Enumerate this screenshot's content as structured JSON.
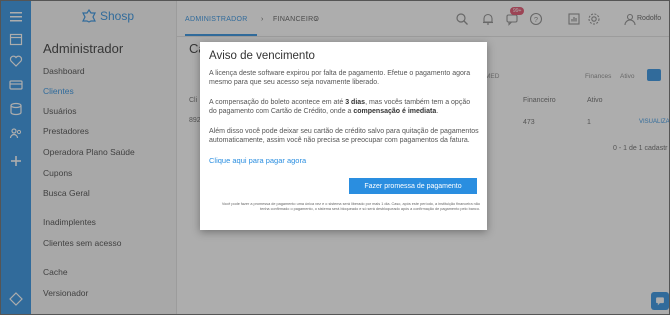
{
  "brand": {
    "name": "Shosp"
  },
  "menu": {
    "title": "Administrador",
    "items": [
      {
        "label": "Dashboard"
      },
      {
        "label": "Clientes"
      },
      {
        "label": "Usuários"
      },
      {
        "label": "Prestadores"
      },
      {
        "label": "Operadora Plano Saúde"
      },
      {
        "label": "Cupons"
      },
      {
        "label": "Busca Geral"
      },
      {
        "label": "Inadimplentes"
      },
      {
        "label": "Clientes sem acesso"
      },
      {
        "label": "Cache"
      },
      {
        "label": "Versionador"
      }
    ],
    "active_item": "Clientes"
  },
  "topbar": {
    "breadcrumbs": [
      "ADMINISTRADOR",
      "FINANCEIRO"
    ],
    "notification_badge": "99+",
    "user_name": "Rodolfo"
  },
  "main": {
    "page_title": "Ca",
    "filter_tabs": [
      "MED",
      "Finances",
      "Ativo"
    ],
    "columns": [
      "Cli",
      "Financeiro",
      "Ativo"
    ],
    "row": {
      "id": "892",
      "financeiro": "473",
      "ativo": "1",
      "action": "VISUALIZA"
    },
    "pagination": "0 - 1 de 1 cadastr"
  },
  "modal": {
    "title": "Aviso de vencimento",
    "p1": "A licença deste software expirou por falta de pagamento. Efetue o pagamento agora mesmo para que seu acesso seja novamente liberado.",
    "p2_a": "A compensação do boleto acontece em até ",
    "p2_b": "3 dias",
    "p2_c": ", mas vocês também tem a opção do pagamento com Cartão de Crédito, onde a ",
    "p2_d": "compensação é imediata",
    "p2_e": ".",
    "p3": "Além disso você pode deixar seu cartão de crédito salvo para quitação de pagamentos automaticamente, assim você não precisa se preocupar com pagamentos da fatura.",
    "link": "Clique aqui para pagar agora",
    "button": "Fazer promessa de pagamento",
    "footnote": "Você pode fazer a promessa de pagamento uma única vez e o sistema será liberado por mais 1 dia. Caso, após este período, a instituição financeira não tenha confirmado o pagamento, o sistema será bloqueado e só será desbloqueado após a confirmação de pagamento pelo banco."
  },
  "colors": {
    "accent": "#2a8ee0",
    "badge": "#e24b68"
  }
}
